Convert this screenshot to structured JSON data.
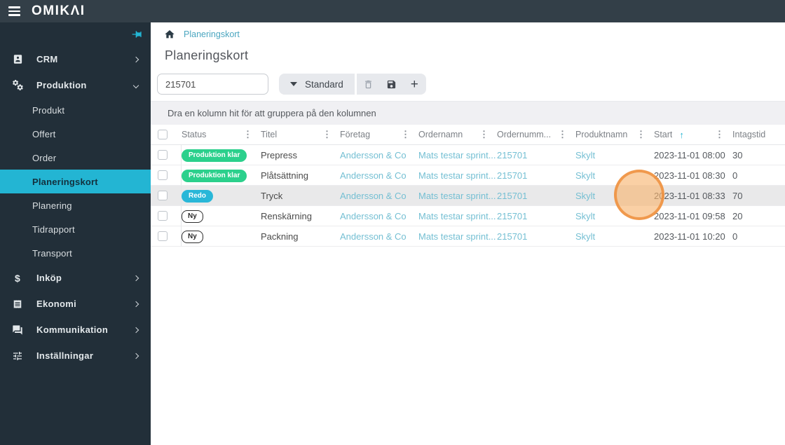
{
  "topbar": {
    "logo": "OMIKΛI"
  },
  "colors": {
    "topbar": "#333f48",
    "sidebar": "#222f39",
    "accent": "#23b5d3",
    "link": "#74bfd3",
    "badge_success": "#2bd08c",
    "badge_info": "#29b7d8",
    "row_highlight": "#e9e9ea",
    "cursor": "#ee913e"
  },
  "sidebar": {
    "sections": [
      {
        "label": "CRM",
        "icon": "contact-card-icon"
      },
      {
        "label": "Produktion",
        "icon": "gears-icon"
      },
      {
        "label": "Inköp",
        "icon": "dollar-icon"
      },
      {
        "label": "Ekonomi",
        "icon": "receipt-icon"
      },
      {
        "label": "Kommunikation",
        "icon": "chat-icon"
      },
      {
        "label": "Inställningar",
        "icon": "sliders-icon"
      }
    ],
    "produktion_items": [
      "Produkt",
      "Offert",
      "Order",
      "Planeringskort",
      "Planering",
      "Tidrapport",
      "Transport"
    ],
    "active_item": "Planeringskort"
  },
  "breadcrumb": {
    "page": "Planeringskort"
  },
  "page": {
    "title": "Planeringskort"
  },
  "toolbar": {
    "search_value": "215701",
    "preset_label": "Standard"
  },
  "grouping_hint": "Dra en kolumn hit för att gruppera på den kolumnen",
  "icons": {
    "dollar": "$",
    "plus": "+",
    "column_menu": "⋮",
    "sort_asc": "↑"
  },
  "table": {
    "headers": {
      "status": "Status",
      "titel": "Titel",
      "foretag": "Företag",
      "ordernamn": "Ordernamn",
      "ordernummer": "Ordernumm...",
      "produktnamn": "Produktnamn",
      "start": "Start",
      "intagstid": "Intagstid"
    },
    "sort": {
      "column": "Start",
      "direction": "asc"
    },
    "rows": [
      {
        "status": "Produktion klar",
        "status_type": "success",
        "titel": "Prepress",
        "foretag": "Andersson & Co",
        "ordernamn": "Mats testar sprint...",
        "ordernummer": "215701",
        "produktnamn": "Skylt",
        "start": "2023-11-01 08:00",
        "intagstid": "30"
      },
      {
        "status": "Produktion klar",
        "status_type": "success",
        "titel": "Plåtsättning",
        "foretag": "Andersson & Co",
        "ordernamn": "Mats testar sprint...",
        "ordernummer": "215701",
        "produktnamn": "Skylt",
        "start": "2023-11-01 08:30",
        "intagstid": "0"
      },
      {
        "status": "Redo",
        "status_type": "info",
        "titel": "Tryck",
        "foretag": "Andersson & Co",
        "ordernamn": "Mats testar sprint...",
        "ordernummer": "215701",
        "produktnamn": "Skylt",
        "start": "2023-11-01 08:33",
        "intagstid": "70"
      },
      {
        "status": "Ny",
        "status_type": "new",
        "titel": "Renskärning",
        "foretag": "Andersson & Co",
        "ordernamn": "Mats testar sprint...",
        "ordernummer": "215701",
        "produktnamn": "Skylt",
        "start": "2023-11-01 09:58",
        "intagstid": "20"
      },
      {
        "status": "Ny",
        "status_type": "new",
        "titel": "Packning",
        "foretag": "Andersson & Co",
        "ordernamn": "Mats testar sprint...",
        "ordernummer": "215701",
        "produktnamn": "Skylt",
        "start": "2023-11-01 10:20",
        "intagstid": "0"
      }
    ]
  }
}
